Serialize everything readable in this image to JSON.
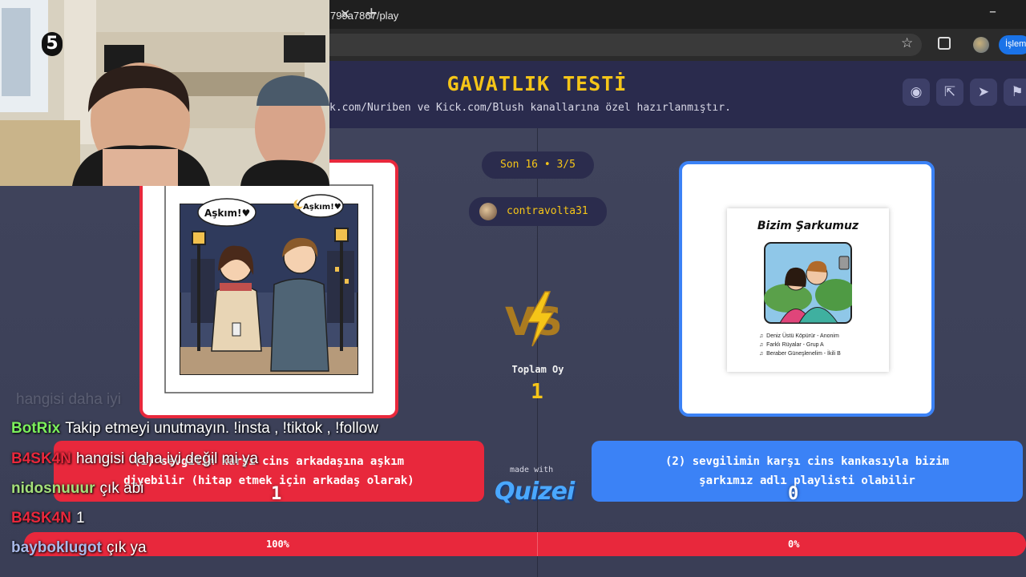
{
  "browser": {
    "url": "799a7867/play",
    "profile_badge": "İşlem"
  },
  "quiz": {
    "title": "GAVATLIK TESTİ",
    "subtitle": "k.com/Nuriben ve Kick.com/Blush kanallarına özel hazırlanmıştır.",
    "round": "Son 16 • 3/5",
    "username": "contravolta31",
    "total_votes_label": "Toplam Oy",
    "total_votes": "1",
    "made_with": "made with",
    "brand": "Quizei"
  },
  "left_option": {
    "line1": "(1) sevgilin karşı cins arkadaşına aşkım",
    "line2": "diyebilir (hitap etmek için arkadaş olarak)",
    "votes": "1",
    "percent": "100%",
    "bubble1": "Aşkım!♥",
    "bubble2": "Aşkım!♥"
  },
  "right_option": {
    "line1": "(2) sevgilimin karşı cins kankasıyla bizim",
    "line2": "şarkımız adlı playlisti olabilir",
    "votes": "0",
    "percent": "0%",
    "card_title": "Bizim Şarkumuz",
    "songs": [
      "Deniz Üstü Köpürür - Anonim",
      "Farklı Rüyalar - Grup A",
      "Beraber Güneşlenelim - İkili B"
    ]
  },
  "vote_share": 1.0,
  "webcam": {
    "number": "5"
  },
  "chat": [
    {
      "user": "BotRix",
      "color": "#7cf05c",
      "msg": "Takip etmeyi unutmayın. !insta , !tiktok , !follow"
    },
    {
      "user": "B4SK4N",
      "color": "#e8283c",
      "msg": "hangisi daha iyi değil mi ya"
    },
    {
      "user": "nidosnuuur",
      "color": "#a4e07a",
      "msg": "çık abi"
    },
    {
      "user": "B4SK4N",
      "color": "#e8283c",
      "msg": "1"
    },
    {
      "user": "bayboklugot",
      "color": "#a9b9e8",
      "msg": "çık ya"
    }
  ],
  "chat_faded": "hangisi daha iyi"
}
